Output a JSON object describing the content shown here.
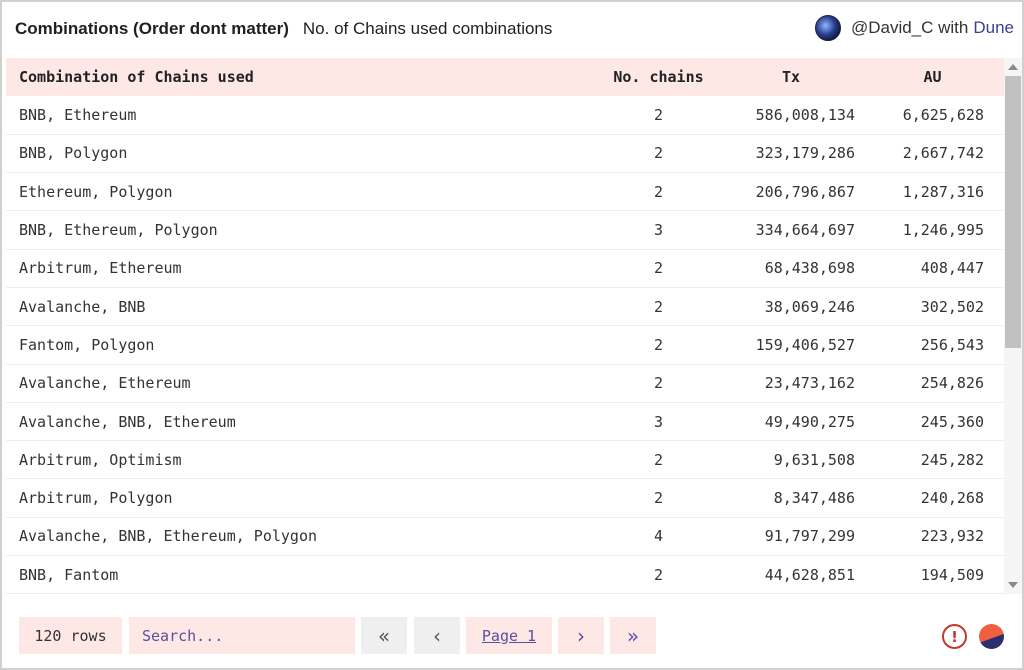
{
  "header": {
    "title": "Combinations (Order dont matter)",
    "subtitle": "No. of Chains used combinations",
    "author": "@David_C with",
    "platform": "Dune"
  },
  "table": {
    "columns": [
      "Combination of Chains used",
      "No. chains",
      "Tx",
      "AU"
    ],
    "rows": [
      [
        "BNB, Ethereum",
        "2",
        "586,008,134",
        "6,625,628"
      ],
      [
        "BNB, Polygon",
        "2",
        "323,179,286",
        "2,667,742"
      ],
      [
        "Ethereum, Polygon",
        "2",
        "206,796,867",
        "1,287,316"
      ],
      [
        "BNB, Ethereum, Polygon",
        "3",
        "334,664,697",
        "1,246,995"
      ],
      [
        "Arbitrum, Ethereum",
        "2",
        "68,438,698",
        "408,447"
      ],
      [
        "Avalanche, BNB",
        "2",
        "38,069,246",
        "302,502"
      ],
      [
        "Fantom, Polygon",
        "2",
        "159,406,527",
        "256,543"
      ],
      [
        "Avalanche, Ethereum",
        "2",
        "23,473,162",
        "254,826"
      ],
      [
        "Avalanche, BNB, Ethereum",
        "3",
        "49,490,275",
        "245,360"
      ],
      [
        "Arbitrum, Optimism",
        "2",
        "9,631,508",
        "245,282"
      ],
      [
        "Arbitrum, Polygon",
        "2",
        "8,347,486",
        "240,268"
      ],
      [
        "Avalanche, BNB, Ethereum, Polygon",
        "4",
        "91,797,299",
        "223,932"
      ],
      [
        "BNB, Fantom",
        "2",
        "44,628,851",
        "194,509"
      ],
      [
        "",
        "",
        "",
        ""
      ]
    ]
  },
  "footer": {
    "row_count": "120 rows",
    "search_placeholder": "Search...",
    "first_icon": "«",
    "prev_icon": "‹",
    "page_label": "Page 1",
    "next_icon": "›",
    "last_icon": "»",
    "warning_icon": "!"
  },
  "colors": {
    "header_row": "#fde8e6",
    "accent": "#5a4fa0",
    "warning": "#c0392b"
  }
}
